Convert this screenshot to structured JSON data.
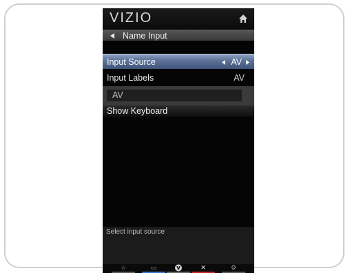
{
  "header": {
    "logo": "VIZIO",
    "home_icon": "home-icon"
  },
  "breadcrumb": {
    "back_icon": "triangle-left-icon",
    "title": "Name Input"
  },
  "menu": {
    "input_source": {
      "label": "Input Source",
      "value": "AV"
    },
    "input_labels": {
      "label": "Input Labels",
      "value": "AV"
    },
    "text_field": {
      "value": "AV"
    },
    "show_keyboard": {
      "label": "Show Keyboard"
    }
  },
  "help": {
    "text": "Select input source"
  },
  "bottom_bar": [
    {
      "icon": "star-icon",
      "glyph": "☆",
      "color": "#5c5c5c"
    },
    {
      "icon": "info-icon",
      "glyph": "▭",
      "color": "#3b79c8"
    },
    {
      "icon": "vizio-v-icon",
      "glyph": "V",
      "color": "#6a6a6a"
    },
    {
      "icon": "close-icon",
      "glyph": "✕",
      "color": "#c22c2c"
    },
    {
      "icon": "gear-icon",
      "glyph": "⚙",
      "color": "#5c5c5c"
    }
  ]
}
